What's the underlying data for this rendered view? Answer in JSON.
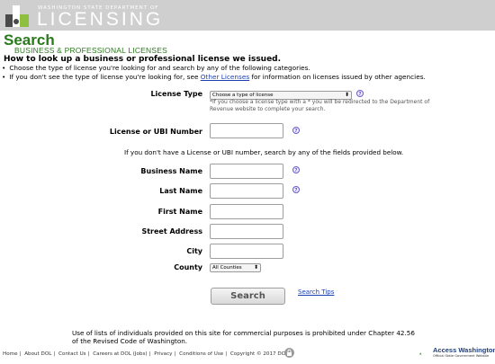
{
  "header": {
    "dept": "WASHINGTON STATE DEPARTMENT OF",
    "title": "LICENSING"
  },
  "page": {
    "title": "Search",
    "subtitle": "BUSINESS & PROFESSIONAL LICENSES",
    "howto": "How to look up a business or professional license we issued.",
    "bullet1": "Choose the type of license you're looking for and search by any of the following categories.",
    "bullet2_pre": "If you don't see the type of license you're looking for, see ",
    "bullet2_link": "Other Licenses",
    "bullet2_post": " for information on licenses issued by other agencies."
  },
  "form": {
    "license_type_label": "License Type",
    "license_type_value": "Choose a type of license",
    "license_type_note": "*If you choose a license type with a * you will be redirected to the Department of Revenue website to complete your search.",
    "license_number_label": "License or UBI Number",
    "license_number_value": "",
    "or_note": "If you don't have a License or UBI number, search by any of the fields provided below.",
    "business_name_label": "Business Name",
    "last_name_label": "Last Name",
    "first_name_label": "First Name",
    "street_address_label": "Street Address",
    "city_label": "City",
    "county_label": "County",
    "county_value": "All Counties",
    "help_glyph": "?",
    "search_button": "Search",
    "search_tips": "Search Tips"
  },
  "legal": "Use of lists of individuals provided on this site for commercial purposes is prohibited under Chapter 42.56 of the Revised Code of Washington.",
  "footer": {
    "links": [
      "Home",
      "About DOL",
      "Contact Us",
      "Careers at DOL (Jobs)",
      "Privacy",
      "Conditions of Use",
      "Copyright © 2017 DOL"
    ],
    "aw_title": "Access Washington",
    "aw_sub": "Official State Government Website"
  },
  "colors": {
    "brand_green": "#2a7a1d",
    "link_blue": "#1a3fb0",
    "header_gray": "#cfcfcf"
  }
}
